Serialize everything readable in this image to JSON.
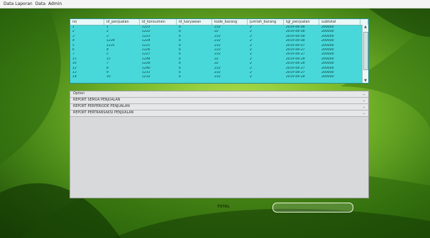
{
  "menu": [
    "Data Laporan",
    "Data",
    "Admin"
  ],
  "table": {
    "columns": [
      "no",
      "id_penjualan",
      "id_konsumen",
      "id_karyawan",
      "kode_barang",
      "jumlah_barang",
      "tgl_penjualan",
      "subtotal"
    ],
    "rows": [
      [
        "1",
        "1",
        "1221",
        "6",
        "232",
        "2",
        "2019-08-08",
        "200000"
      ],
      [
        "2",
        "2",
        "1222",
        "6",
        "22",
        "2",
        "2019-08-08",
        "200000"
      ],
      [
        "3",
        "3",
        "1223",
        "6",
        "232",
        "2",
        "2019-08-08",
        "200000"
      ],
      [
        "4",
        "1234",
        "1224",
        "6",
        "232",
        "2",
        "2019-08-08",
        "200000"
      ],
      [
        "5",
        "1235",
        "1225",
        "6",
        "232",
        "2",
        "2019-08-07",
        "200000"
      ],
      [
        "6",
        "4",
        "1226",
        "6",
        "232",
        "2",
        "2019-08-27",
        "200000"
      ],
      [
        "7",
        "5",
        "1227",
        "6",
        "232",
        "2",
        "2019-08-27",
        "200000"
      ],
      [
        "15",
        "15",
        "1244",
        "6",
        "22",
        "2",
        "2019-08-28",
        "200000"
      ],
      [
        "16",
        "7",
        "1228",
        "6",
        "22",
        "2",
        "2019-08-28",
        "200000"
      ],
      [
        "12",
        "8",
        "1240",
        "6",
        "232",
        "2",
        "2019-08-27",
        "200000"
      ],
      [
        "13",
        "9",
        "1231",
        "6",
        "232",
        "2",
        "2019-08-27",
        "200000"
      ],
      [
        "14",
        "10",
        "1232",
        "6",
        "232",
        "2",
        "2019-08-28",
        "200000"
      ]
    ]
  },
  "sections": [
    {
      "label": "Option"
    },
    {
      "label": "REPORT SEMUA PENJUALAN"
    },
    {
      "label": "REPORT PERPERIODE PENJUALAN"
    },
    {
      "label": "REPORT PERTRANSAKSI PENJUALAN"
    }
  ],
  "total": {
    "label": "TOTAL",
    "value": ""
  }
}
